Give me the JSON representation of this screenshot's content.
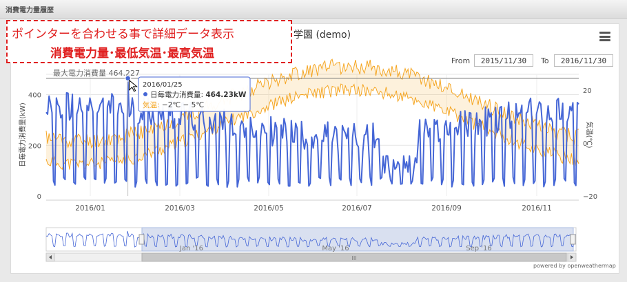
{
  "window": {
    "title": "消費電力量履歴"
  },
  "annotation": {
    "line1": "ポインターを合わせる事で詳細データ表示",
    "line2": "消費電力量･最低気温･最高気温"
  },
  "chart_title": "学園 (demo)",
  "range": {
    "from_label": "From",
    "from_value": "2015/11/30",
    "to_label": "To",
    "to_value": "2016/11/30"
  },
  "credit": "powered by openweathermap",
  "chart_data": {
    "type": "line",
    "x_ticks": [
      "2016/01",
      "2016/03",
      "2016/05",
      "2016/07",
      "2016/09",
      "2016/11"
    ],
    "navigator_ticks": [
      "Jan '16",
      "May '16",
      "Sep '16"
    ],
    "y_left": {
      "label": "日毎電力消費量(kW)",
      "ticks": [
        "0",
        "200",
        "400"
      ],
      "range": [
        0,
        480
      ]
    },
    "y_right": {
      "label": "気温(℃)",
      "ticks": [
        "−20",
        "0",
        "20"
      ],
      "range": [
        -20,
        26
      ]
    },
    "max_line": {
      "label": "最大電力消費量 464.227",
      "value": 464.23
    },
    "series": [
      {
        "name": "日毎電力消費量",
        "color": "#4566d6"
      },
      {
        "name": "気温",
        "color": "#f5a623"
      }
    ],
    "tooltip": {
      "date": "2016/01/25",
      "series_label": "日毎電力消費量: ",
      "series_value": "464.23kW",
      "temp_label": "気温: ",
      "temp_value": "−2℃ − 5℃"
    }
  }
}
